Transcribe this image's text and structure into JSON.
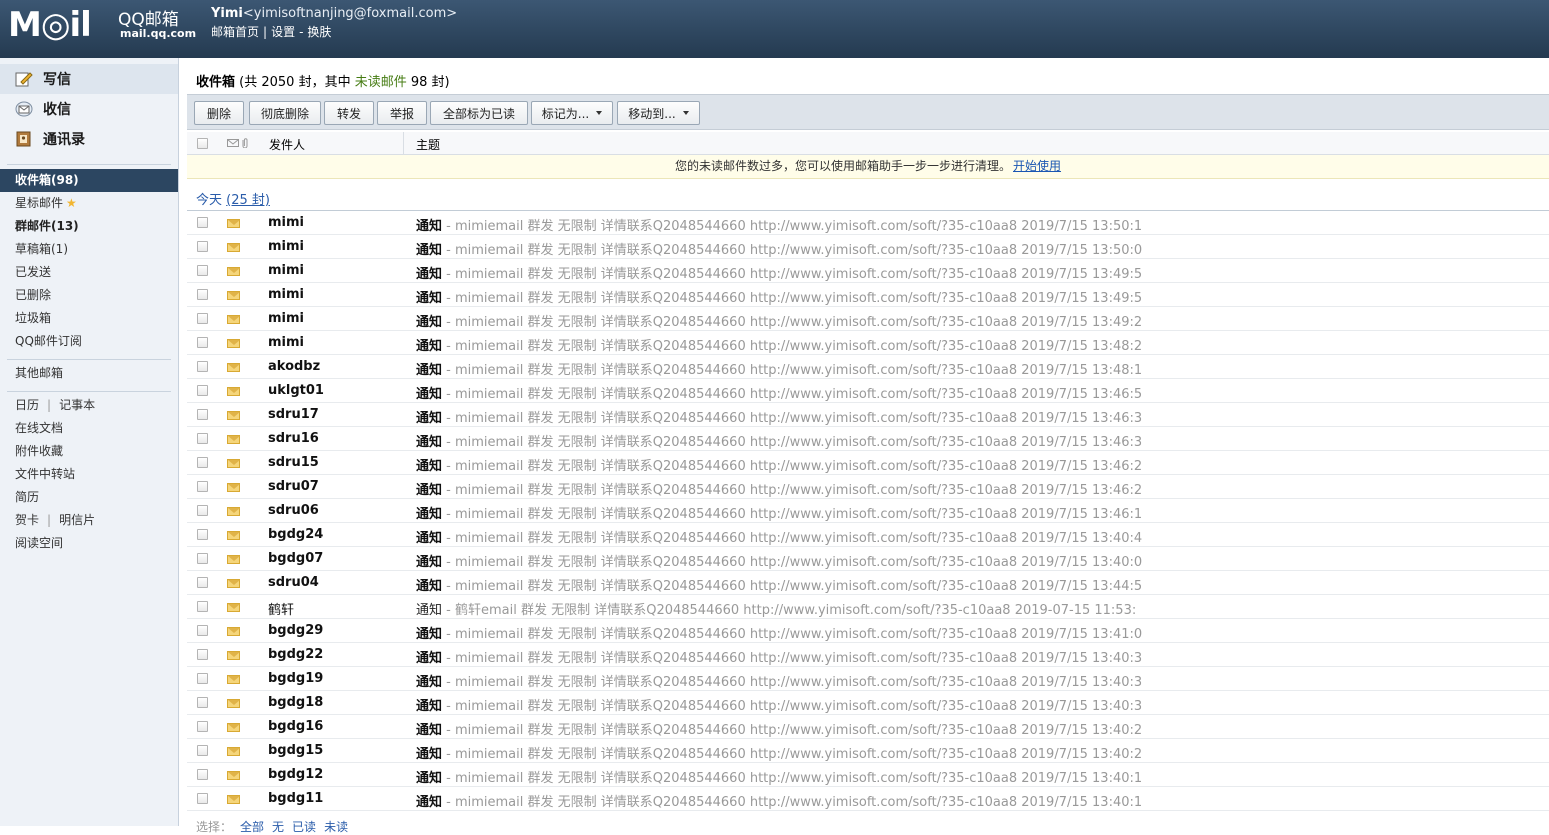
{
  "header": {
    "logo_text": "M◎il",
    "logo_product": "QQ邮箱",
    "logo_domain": "mail.qq.com",
    "user_name": "Yimi",
    "user_email": "<yimisoftnanjing@foxmail.com>",
    "link_home": "邮箱首页",
    "link_settings": "设置",
    "link_skin": "换肤"
  },
  "sidebar": {
    "compose": "写信",
    "receive": "收信",
    "contacts": "通讯录",
    "folders": {
      "inbox": "收件箱(98)",
      "starred": "星标邮件",
      "group": "群邮件(13)",
      "drafts": "草稿箱(1)",
      "sent": "已发送",
      "deleted": "已删除",
      "spam": "垃圾箱",
      "subscriptions": "QQ邮件订阅",
      "other": "其他邮箱",
      "calendar": "日历",
      "notebook": "记事本",
      "docs": "在线文档",
      "attachments": "附件收藏",
      "transfer": "文件中转站",
      "resume": "简历",
      "cards": "贺卡",
      "postcards": "明信片",
      "reading": "阅读空间"
    }
  },
  "main": {
    "title_prefix": "收件箱",
    "title_middle": " (共 2050 封，其中 ",
    "title_unread": "未读邮件",
    "title_suffix": " 98 封)",
    "toolbar": {
      "delete": "删除",
      "delete_permanent": "彻底删除",
      "forward": "转发",
      "report": "举报",
      "mark_all_read": "全部标为已读",
      "mark_as": "标记为...",
      "move_to": "移动到..."
    },
    "columns": {
      "sender": "发件人",
      "subject": "主题"
    },
    "notice_text": "您的未读邮件数过多，您可以使用邮箱助手一步一步进行清理。",
    "notice_link": "开始使用",
    "group_today": "今天",
    "group_count": "(25 封)",
    "rows": [
      {
        "sender": "mimi",
        "subject": "通知",
        "preview": " - mimiemail 群发 无限制 详情联系Q2048544660 http://www.yimisoft.com/soft/?35-c10aa8 2019/7/15 13:50:1"
      },
      {
        "sender": "mimi",
        "subject": "通知",
        "preview": " - mimiemail 群发 无限制 详情联系Q2048544660 http://www.yimisoft.com/soft/?35-c10aa8 2019/7/15 13:50:0"
      },
      {
        "sender": "mimi",
        "subject": "通知",
        "preview": " - mimiemail 群发 无限制 详情联系Q2048544660 http://www.yimisoft.com/soft/?35-c10aa8 2019/7/15 13:49:5"
      },
      {
        "sender": "mimi",
        "subject": "通知",
        "preview": " - mimiemail 群发 无限制 详情联系Q2048544660 http://www.yimisoft.com/soft/?35-c10aa8 2019/7/15 13:49:5"
      },
      {
        "sender": "mimi",
        "subject": "通知",
        "preview": " - mimiemail 群发 无限制 详情联系Q2048544660 http://www.yimisoft.com/soft/?35-c10aa8 2019/7/15 13:49:2"
      },
      {
        "sender": "mimi",
        "subject": "通知",
        "preview": " - mimiemail 群发 无限制 详情联系Q2048544660 http://www.yimisoft.com/soft/?35-c10aa8 2019/7/15 13:48:2"
      },
      {
        "sender": "akodbz",
        "subject": "通知",
        "preview": " - mimiemail 群发 无限制 详情联系Q2048544660 http://www.yimisoft.com/soft/?35-c10aa8 2019/7/15 13:48:1"
      },
      {
        "sender": "uklgt01",
        "subject": "通知",
        "preview": " - mimiemail 群发 无限制 详情联系Q2048544660 http://www.yimisoft.com/soft/?35-c10aa8 2019/7/15 13:46:5"
      },
      {
        "sender": "sdru17",
        "subject": "通知",
        "preview": " - mimiemail 群发 无限制 详情联系Q2048544660 http://www.yimisoft.com/soft/?35-c10aa8 2019/7/15 13:46:3"
      },
      {
        "sender": "sdru16",
        "subject": "通知",
        "preview": " - mimiemail 群发 无限制 详情联系Q2048544660 http://www.yimisoft.com/soft/?35-c10aa8 2019/7/15 13:46:3"
      },
      {
        "sender": "sdru15",
        "subject": "通知",
        "preview": " - mimiemail 群发 无限制 详情联系Q2048544660 http://www.yimisoft.com/soft/?35-c10aa8 2019/7/15 13:46:2"
      },
      {
        "sender": "sdru07",
        "subject": "通知",
        "preview": " - mimiemail 群发 无限制 详情联系Q2048544660 http://www.yimisoft.com/soft/?35-c10aa8 2019/7/15 13:46:2"
      },
      {
        "sender": "sdru06",
        "subject": "通知",
        "preview": " - mimiemail 群发 无限制 详情联系Q2048544660 http://www.yimisoft.com/soft/?35-c10aa8 2019/7/15 13:46:1"
      },
      {
        "sender": "bgdg24",
        "subject": "通知",
        "preview": " - mimiemail 群发 无限制 详情联系Q2048544660 http://www.yimisoft.com/soft/?35-c10aa8 2019/7/15 13:40:4"
      },
      {
        "sender": "bgdg07",
        "subject": "通知",
        "preview": " - mimiemail 群发 无限制 详情联系Q2048544660 http://www.yimisoft.com/soft/?35-c10aa8 2019/7/15 13:40:0"
      },
      {
        "sender": "sdru04",
        "subject": "通知",
        "preview": " - mimiemail 群发 无限制 详情联系Q2048544660 http://www.yimisoft.com/soft/?35-c10aa8 2019/7/15 13:44:5"
      },
      {
        "sender": "鹤轩",
        "subject": "通知",
        "preview": " - 鹤轩email 群发 无限制 详情联系Q2048544660 http://www.yimisoft.com/soft/?35-c10aa8 2019-07-15 11:53:",
        "read": true
      },
      {
        "sender": "bgdg29",
        "subject": "通知",
        "preview": " - mimiemail 群发 无限制 详情联系Q2048544660 http://www.yimisoft.com/soft/?35-c10aa8 2019/7/15 13:41:0"
      },
      {
        "sender": "bgdg22",
        "subject": "通知",
        "preview": " - mimiemail 群发 无限制 详情联系Q2048544660 http://www.yimisoft.com/soft/?35-c10aa8 2019/7/15 13:40:3"
      },
      {
        "sender": "bgdg19",
        "subject": "通知",
        "preview": " - mimiemail 群发 无限制 详情联系Q2048544660 http://www.yimisoft.com/soft/?35-c10aa8 2019/7/15 13:40:3"
      },
      {
        "sender": "bgdg18",
        "subject": "通知",
        "preview": " - mimiemail 群发 无限制 详情联系Q2048544660 http://www.yimisoft.com/soft/?35-c10aa8 2019/7/15 13:40:3"
      },
      {
        "sender": "bgdg16",
        "subject": "通知",
        "preview": " - mimiemail 群发 无限制 详情联系Q2048544660 http://www.yimisoft.com/soft/?35-c10aa8 2019/7/15 13:40:2"
      },
      {
        "sender": "bgdg15",
        "subject": "通知",
        "preview": " - mimiemail 群发 无限制 详情联系Q2048544660 http://www.yimisoft.com/soft/?35-c10aa8 2019/7/15 13:40:2"
      },
      {
        "sender": "bgdg12",
        "subject": "通知",
        "preview": " - mimiemail 群发 无限制 详情联系Q2048544660 http://www.yimisoft.com/soft/?35-c10aa8 2019/7/15 13:40:1"
      },
      {
        "sender": "bgdg11",
        "subject": "通知",
        "preview": " - mimiemail 群发 无限制 详情联系Q2048544660 http://www.yimisoft.com/soft/?35-c10aa8 2019/7/15 13:40:1"
      }
    ],
    "footer": {
      "select_label": "选择：",
      "all": "全部",
      "none": "无",
      "read": "已读",
      "unread": "未读"
    }
  }
}
